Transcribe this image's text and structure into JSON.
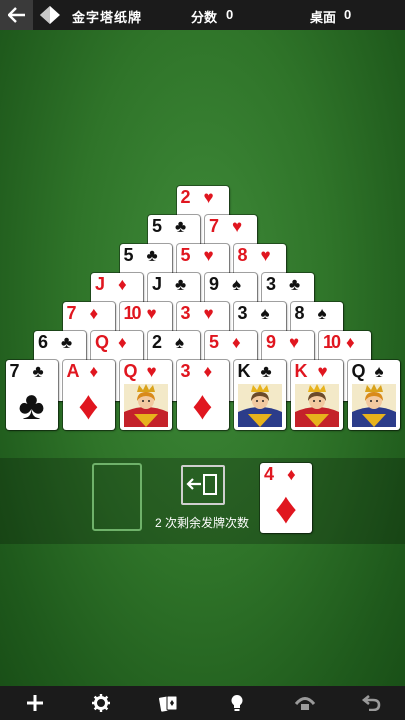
{
  "header": {
    "back_icon": "back-arrow-icon",
    "title": "金字塔纸牌",
    "score_label": "分数",
    "score_value": "0",
    "board_label": "桌面",
    "board_value": "0"
  },
  "pyramid": {
    "rows": [
      [
        {
          "rank": "2",
          "suit": "♥",
          "color": "red"
        }
      ],
      [
        {
          "rank": "5",
          "suit": "♣",
          "color": "black"
        },
        {
          "rank": "7",
          "suit": "♥",
          "color": "red"
        }
      ],
      [
        {
          "rank": "5",
          "suit": "♣",
          "color": "black"
        },
        {
          "rank": "5",
          "suit": "♥",
          "color": "red"
        },
        {
          "rank": "8",
          "suit": "♥",
          "color": "red"
        }
      ],
      [
        {
          "rank": "J",
          "suit": "♦",
          "color": "red"
        },
        {
          "rank": "J",
          "suit": "♣",
          "color": "black"
        },
        {
          "rank": "9",
          "suit": "♠",
          "color": "black"
        },
        {
          "rank": "3",
          "suit": "♣",
          "color": "black"
        }
      ],
      [
        {
          "rank": "7",
          "suit": "♦",
          "color": "red"
        },
        {
          "rank": "10",
          "suit": "♥",
          "color": "red"
        },
        {
          "rank": "3",
          "suit": "♥",
          "color": "red"
        },
        {
          "rank": "3",
          "suit": "♠",
          "color": "black"
        },
        {
          "rank": "8",
          "suit": "♠",
          "color": "black"
        }
      ],
      [
        {
          "rank": "6",
          "suit": "♣",
          "color": "black"
        },
        {
          "rank": "Q",
          "suit": "♦",
          "color": "red"
        },
        {
          "rank": "2",
          "suit": "♠",
          "color": "black"
        },
        {
          "rank": "5",
          "suit": "♦",
          "color": "red"
        },
        {
          "rank": "9",
          "suit": "♥",
          "color": "red"
        },
        {
          "rank": "10",
          "suit": "♦",
          "color": "red"
        }
      ],
      [
        {
          "rank": "7",
          "suit": "♣",
          "color": "black",
          "face": "pip"
        },
        {
          "rank": "A",
          "suit": "♦",
          "color": "red",
          "face": "pip"
        },
        {
          "rank": "Q",
          "suit": "♥",
          "color": "red",
          "face": "queen"
        },
        {
          "rank": "3",
          "suit": "♦",
          "color": "red",
          "face": "pip"
        },
        {
          "rank": "K",
          "suit": "♣",
          "color": "black",
          "face": "king"
        },
        {
          "rank": "K",
          "suit": "♥",
          "color": "red",
          "face": "king"
        },
        {
          "rank": "Q",
          "suit": "♠",
          "color": "black",
          "face": "queen"
        }
      ]
    ]
  },
  "stock": {
    "recycle_icon": "recycle-deck-icon",
    "deals_remaining_text": "2 次剩余发牌次数"
  },
  "waste_card": {
    "rank": "4",
    "suit": "♦",
    "color": "red"
  },
  "toolbar": {
    "items": [
      "new-game-icon",
      "settings-icon",
      "cards-icon",
      "hint-icon",
      "auto-play-icon",
      "undo-icon"
    ]
  },
  "colors": {
    "felt": "#2f7429",
    "header_bg": "#1b1b1b",
    "red_suit": "#e0161f",
    "slot_border": "#6fb26a"
  }
}
